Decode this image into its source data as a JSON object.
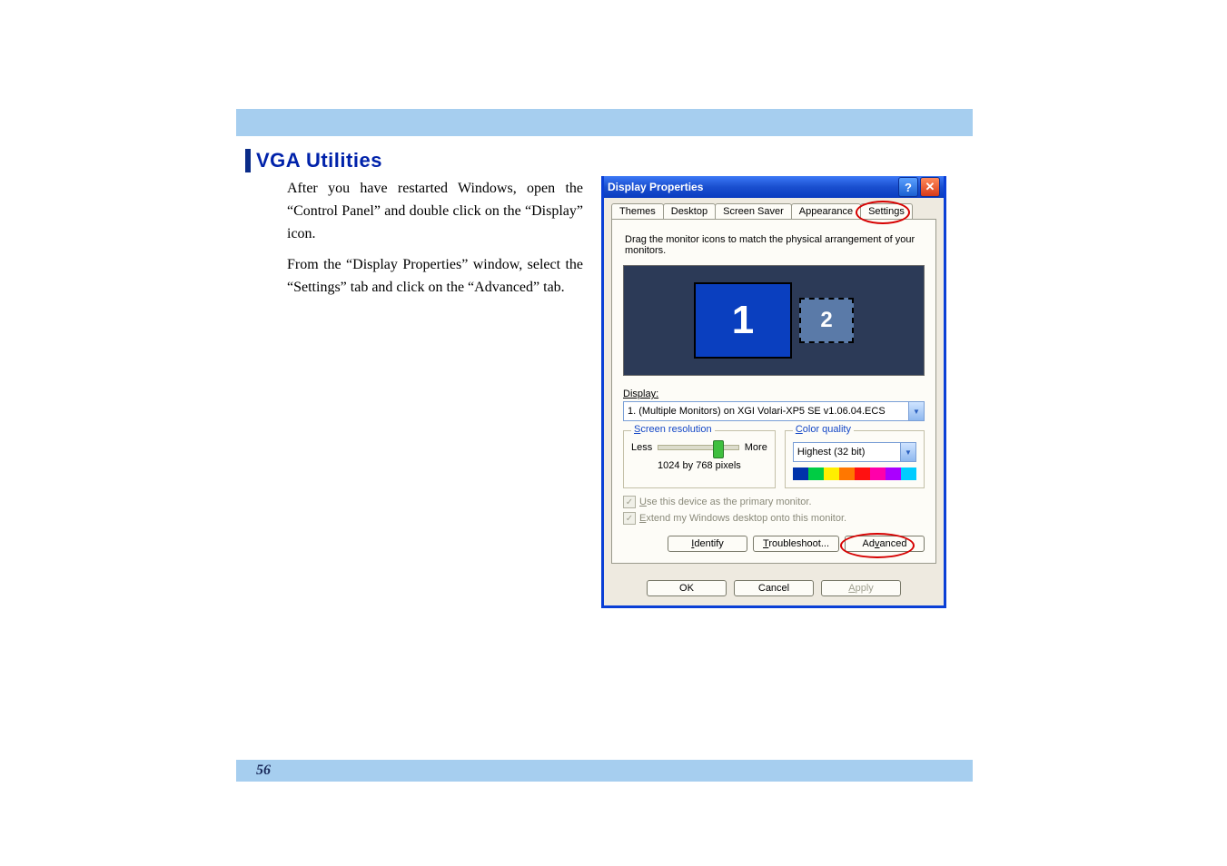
{
  "doc": {
    "heading": "VGA Utilities",
    "para1": "After you have restarted Windows, open the “Control Panel” and double click on the “Display” icon.",
    "para2": "From the “Display Properties” window, select the “Settings” tab and click on the “Advanced” tab.",
    "page_number": "56"
  },
  "dialog": {
    "title": "Display Properties",
    "help_glyph": "?",
    "close_glyph": "✕",
    "tabs": {
      "themes": "Themes",
      "desktop": "Desktop",
      "screen_saver": "Screen Saver",
      "appearance": "Appearance",
      "settings": "Settings"
    },
    "instruction": "Drag the monitor icons to match the physical arrangement of your monitors.",
    "monitor1": "1",
    "monitor2": "2",
    "display_label": "Display:",
    "display_value": "1. (Multiple Monitors) on XGI Volari-XP5 SE  v1.06.04.ECS",
    "screen_res": {
      "legend": "Screen resolution",
      "less": "Less",
      "more": "More",
      "value": "1024 by 768 pixels"
    },
    "color_quality": {
      "legend": "Color quality",
      "value": "Highest (32 bit)"
    },
    "checks": {
      "primary": "Use this device as the primary monitor.",
      "extend": "Extend my Windows desktop onto this monitor."
    },
    "buttons": {
      "identify": "Identify",
      "troubleshoot": "Troubleshoot...",
      "advanced": "Advanced",
      "ok": "OK",
      "cancel": "Cancel",
      "apply": "Apply"
    },
    "dropdown_glyph": "▼"
  },
  "colors": {
    "strip": [
      "#0033aa",
      "#00cc44",
      "#ffee00",
      "#ff7700",
      "#ff1111",
      "#ff00aa",
      "#aa00ff",
      "#00ccff"
    ]
  }
}
